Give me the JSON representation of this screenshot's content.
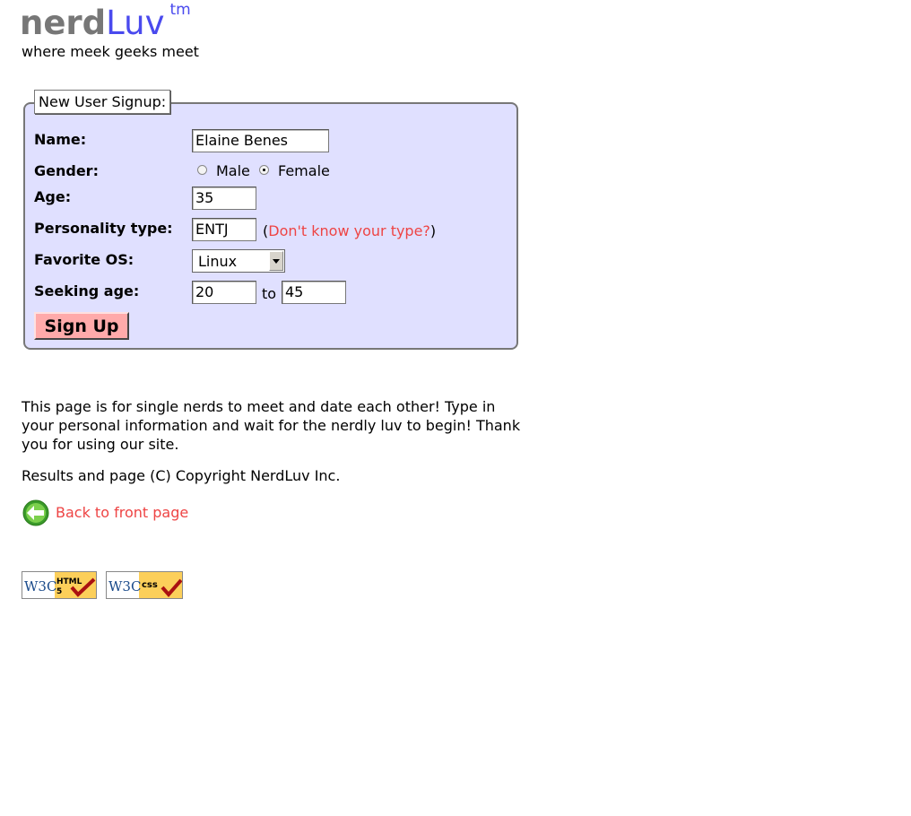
{
  "header": {
    "logo_part1": "nerd",
    "logo_part2": "Luv",
    "logo_tm": "tm",
    "tagline": "where meek geeks meet"
  },
  "form": {
    "legend": "New User Signup:",
    "name_label": "Name:",
    "name_value": "Elaine Benes",
    "gender_label": "Gender:",
    "gender_options": [
      "Male",
      "Female"
    ],
    "gender_selected": "Female",
    "age_label": "Age:",
    "age_value": "35",
    "personality_label": "Personality type:",
    "personality_value": "ENTJ",
    "personality_help_open": "(",
    "personality_help_link": "Don't know your type?",
    "personality_help_close": ")",
    "os_label": "Favorite OS:",
    "os_selected": "Linux",
    "seeking_label": "Seeking age:",
    "seeking_min": "20",
    "seeking_to": "to",
    "seeking_max": "45",
    "submit_label": "Sign Up"
  },
  "content": {
    "description": "This page is for single nerds to meet and date each other! Type in your personal information and wait for the nerdly luv to begin! Thank you for using our site.",
    "copyright": "Results and page (C) Copyright NerdLuv Inc.",
    "back_link": "Back to front page"
  },
  "badges": {
    "html": {
      "w3c": "W3C",
      "label1": "HTML",
      "label2": "5"
    },
    "css": {
      "w3c": "W3C",
      "label1": "css"
    }
  },
  "colors": {
    "accent_link": "#ee4444",
    "form_bg": "#e0e0ff",
    "logo_gray": "#777777",
    "logo_blue": "#4a4aee",
    "button_bg": "#ffaaaa"
  }
}
